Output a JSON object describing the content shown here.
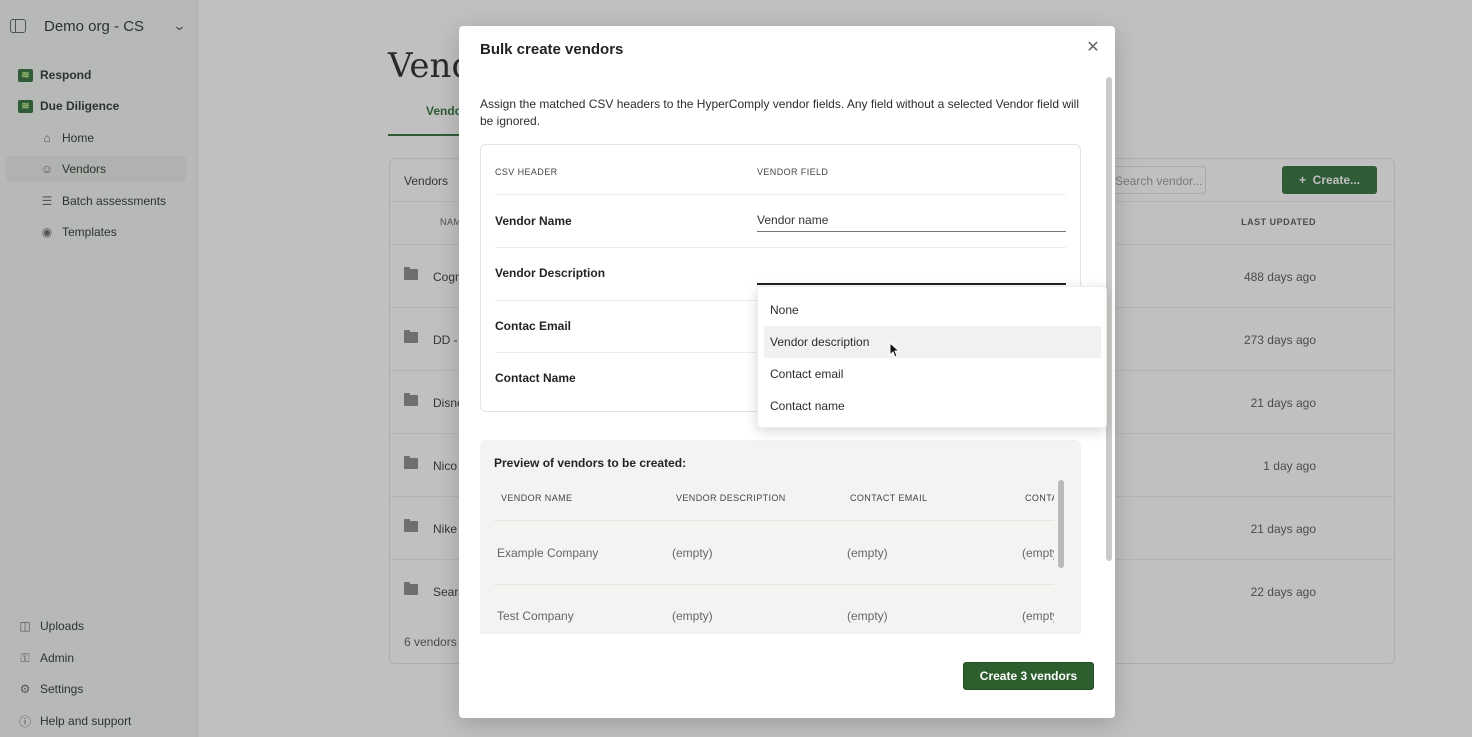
{
  "sidebar": {
    "org_name": "Demo org - CS",
    "items": [
      {
        "label": "Respond"
      },
      {
        "label": "Due Diligence"
      },
      {
        "label": "Home"
      },
      {
        "label": "Vendors"
      },
      {
        "label": "Batch assessments"
      },
      {
        "label": "Templates"
      }
    ],
    "bottom_items": [
      {
        "label": "Uploads"
      },
      {
        "label": "Admin"
      },
      {
        "label": "Settings"
      },
      {
        "label": "Help and support"
      }
    ]
  },
  "background": {
    "page_title": "Vendors",
    "active_tab": "Vendors",
    "card_title": "Vendors",
    "search_placeholder": "Search vendor...",
    "create_button": "Create...",
    "columns": {
      "name": "NAME",
      "last_updated": "LAST UPDATED"
    },
    "rows": [
      {
        "name": "Cogn...",
        "updated": "488 days ago"
      },
      {
        "name": "DD - ...",
        "updated": "273 days ago"
      },
      {
        "name": "Disne...",
        "updated": "21 days ago"
      },
      {
        "name": "Nico ...",
        "updated": "1 day ago"
      },
      {
        "name": "Nike ...",
        "updated": "21 days ago"
      },
      {
        "name": "Sear...",
        "updated": "22 days ago"
      }
    ],
    "footer_count": "6 vendors"
  },
  "modal": {
    "title": "Bulk create vendors",
    "intro": "Assign the matched CSV headers to the HyperComply vendor fields. Any field without a selected Vendor field will be ignored.",
    "mapping": {
      "csv_header_label": "CSV HEADER",
      "vendor_field_label": "VENDOR FIELD",
      "rows": [
        {
          "csv": "Vendor Name",
          "field": "Vendor name"
        },
        {
          "csv": "Vendor Description",
          "field": ""
        },
        {
          "csv": "Contac Email",
          "field": ""
        },
        {
          "csv": "Contact Name",
          "field": ""
        }
      ]
    },
    "preview": {
      "title": "Preview of vendors to be created:",
      "columns": [
        "VENDOR NAME",
        "VENDOR DESCRIPTION",
        "CONTACT EMAIL",
        "CONTACT NAME"
      ],
      "rows": [
        [
          "Example Company",
          "(empty)",
          "(empty)",
          "(empty)"
        ],
        [
          "Test Company",
          "(empty)",
          "(empty)",
          "(empty)"
        ]
      ]
    },
    "submit_button": "Create 3 vendors"
  },
  "dropdown": {
    "options": [
      {
        "label": "None"
      },
      {
        "label": "Vendor description",
        "hovered": true
      },
      {
        "label": "Contact email"
      },
      {
        "label": "Contact name"
      }
    ]
  },
  "colors": {
    "brand_green": "#2c5e2e",
    "logo_accent": "#bff28a"
  }
}
